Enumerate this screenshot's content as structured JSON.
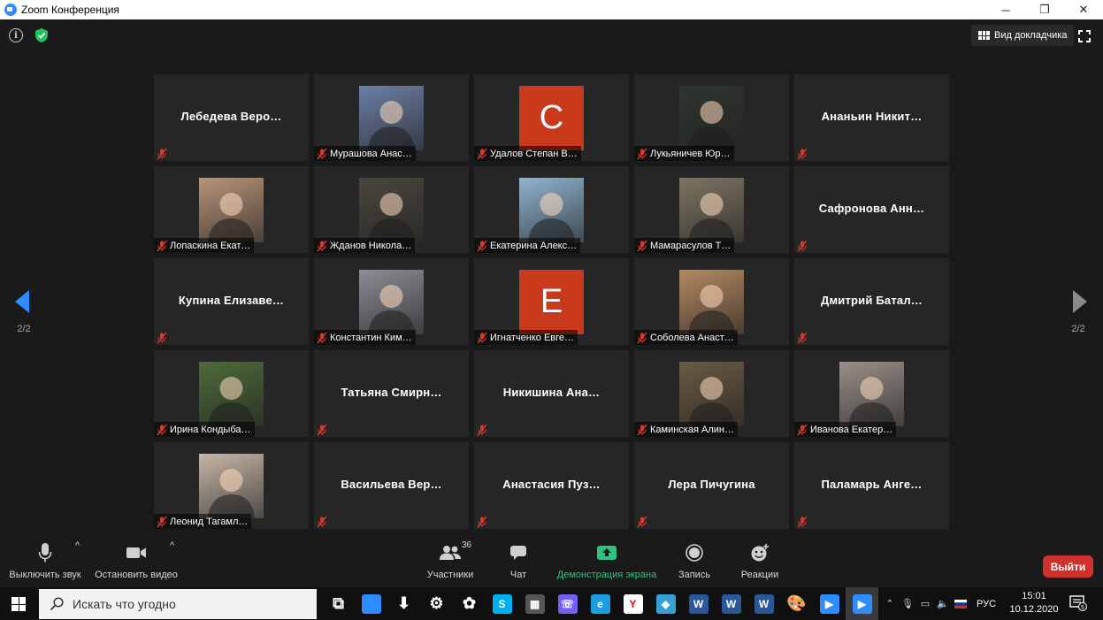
{
  "window": {
    "title": "Zoom Конференция",
    "minimize": "─",
    "restore": "❐",
    "close": "✕"
  },
  "topbar": {
    "info_label": "i",
    "speaker_view": "Вид докладчика"
  },
  "nav": {
    "left_page": "2/2",
    "right_page": "2/2"
  },
  "participants": [
    {
      "name": "Лебедева  Веро…",
      "label": "",
      "avatar": "none"
    },
    {
      "name": "",
      "label": "Мурашова Анас…",
      "avatar": "photo",
      "color": "#6d7fa6"
    },
    {
      "name": "",
      "label": "Удалов Степан В…",
      "avatar": "letter",
      "letter": "С"
    },
    {
      "name": "",
      "label": "Лукьяничев Юр…",
      "avatar": "photo",
      "color": "#2f3530"
    },
    {
      "name": "Ананьин  Никит…",
      "label": "",
      "avatar": "none"
    },
    {
      "name": "",
      "label": "Лопаскина Екат…",
      "avatar": "photo",
      "color": "#b89478"
    },
    {
      "name": "",
      "label": "Жданов Никола…",
      "avatar": "photo",
      "color": "#4a463f"
    },
    {
      "name": "",
      "label": "Екатерина Алекс…",
      "avatar": "photo",
      "color": "#8fb4cf"
    },
    {
      "name": "",
      "label": "Мамарасулов Т…",
      "avatar": "photo",
      "color": "#7d7563"
    },
    {
      "name": "Сафронова  Анн…",
      "label": "",
      "avatar": "none"
    },
    {
      "name": "Купина  Елизаве…",
      "label": "",
      "avatar": "none"
    },
    {
      "name": "",
      "label": "Константин Ким…",
      "avatar": "photo",
      "color": "#8c8d95"
    },
    {
      "name": "",
      "label": "Игнатченко Евге…",
      "avatar": "letter",
      "letter": "Е"
    },
    {
      "name": "",
      "label": "Соболева Анаст…",
      "avatar": "photo",
      "color": "#b48a62"
    },
    {
      "name": "Дмитрий  Батал…",
      "label": "",
      "avatar": "none"
    },
    {
      "name": "",
      "label": "Ирина Кондыба…",
      "avatar": "photo",
      "color": "#4d6b3a"
    },
    {
      "name": "Татьяна  Смирн…",
      "label": "",
      "avatar": "none"
    },
    {
      "name": "Никишина  Ана…",
      "label": "",
      "avatar": "none"
    },
    {
      "name": "",
      "label": "Каминская Алин…",
      "avatar": "photo",
      "color": "#6a5a44"
    },
    {
      "name": "",
      "label": "Иванова Екатер…",
      "avatar": "photo",
      "color": "#9b8f8a"
    },
    {
      "name": "",
      "label": "Леонид Тагамл…",
      "avatar": "photo",
      "color": "#c7b6a6"
    },
    {
      "name": "Васильева  Вер…",
      "label": "",
      "avatar": "none"
    },
    {
      "name": "Анастасия  Пуз…",
      "label": "",
      "avatar": "none"
    },
    {
      "name": "Лера Пичугина",
      "label": "",
      "avatar": "none"
    },
    {
      "name": "Паламарь  Анге…",
      "label": "",
      "avatar": "none"
    }
  ],
  "controls": {
    "mute": "Выключить звук",
    "video": "Остановить видео",
    "participants": "Участники",
    "participants_count": "36",
    "chat": "Чат",
    "share": "Демонстрация экрана",
    "record": "Запись",
    "reactions": "Реакции",
    "leave": "Выйти",
    "caret": "^"
  },
  "colors": {
    "accent": "#2d8cff",
    "share_green": "#2ec27e",
    "leave_red": "#d0312d",
    "letter_avatar": "#c9391b",
    "muted_red": "#e0352b"
  },
  "taskbar": {
    "search_placeholder": "Искать что угодно",
    "tray_lang": "РУС",
    "time": "15:01",
    "date": "10.12.2020",
    "notif_count": "5",
    "apps": [
      {
        "name": "task-view-icon",
        "glyph": "⧉",
        "bg": "transparent"
      },
      {
        "name": "desktop-app-icon",
        "glyph": "",
        "bg": "#2d8cff"
      },
      {
        "name": "download-icon",
        "glyph": "⬇",
        "bg": "transparent"
      },
      {
        "name": "settings-gear-icon",
        "glyph": "⚙",
        "bg": "transparent"
      },
      {
        "name": "clover-app-icon",
        "glyph": "✿",
        "bg": "transparent"
      },
      {
        "name": "skype-icon",
        "glyph": "S",
        "bg": "#00aff0"
      },
      {
        "name": "calculator-icon",
        "glyph": "▦",
        "bg": "#555"
      },
      {
        "name": "viber-icon",
        "glyph": "☏",
        "bg": "#7360f2"
      },
      {
        "name": "edge-icon",
        "glyph": "e",
        "bg": "#1b9de2"
      },
      {
        "name": "yandex-browser-icon",
        "glyph": "Y",
        "bg": "#ffffff"
      },
      {
        "name": "paint-app-icon",
        "glyph": "◆",
        "bg": "#35a0d8"
      },
      {
        "name": "word-icon-1",
        "glyph": "W",
        "bg": "#2b579a"
      },
      {
        "name": "word-icon-2",
        "glyph": "W",
        "bg": "#2b579a"
      },
      {
        "name": "word-icon-3",
        "glyph": "W",
        "bg": "#2b579a"
      },
      {
        "name": "paint-palette-icon",
        "glyph": "🎨",
        "bg": "transparent"
      },
      {
        "name": "zoom-taskbar-icon",
        "glyph": "▶",
        "bg": "#2d8cff"
      },
      {
        "name": "zoom-active-icon",
        "glyph": "▶",
        "bg": "#2d8cff"
      }
    ]
  }
}
